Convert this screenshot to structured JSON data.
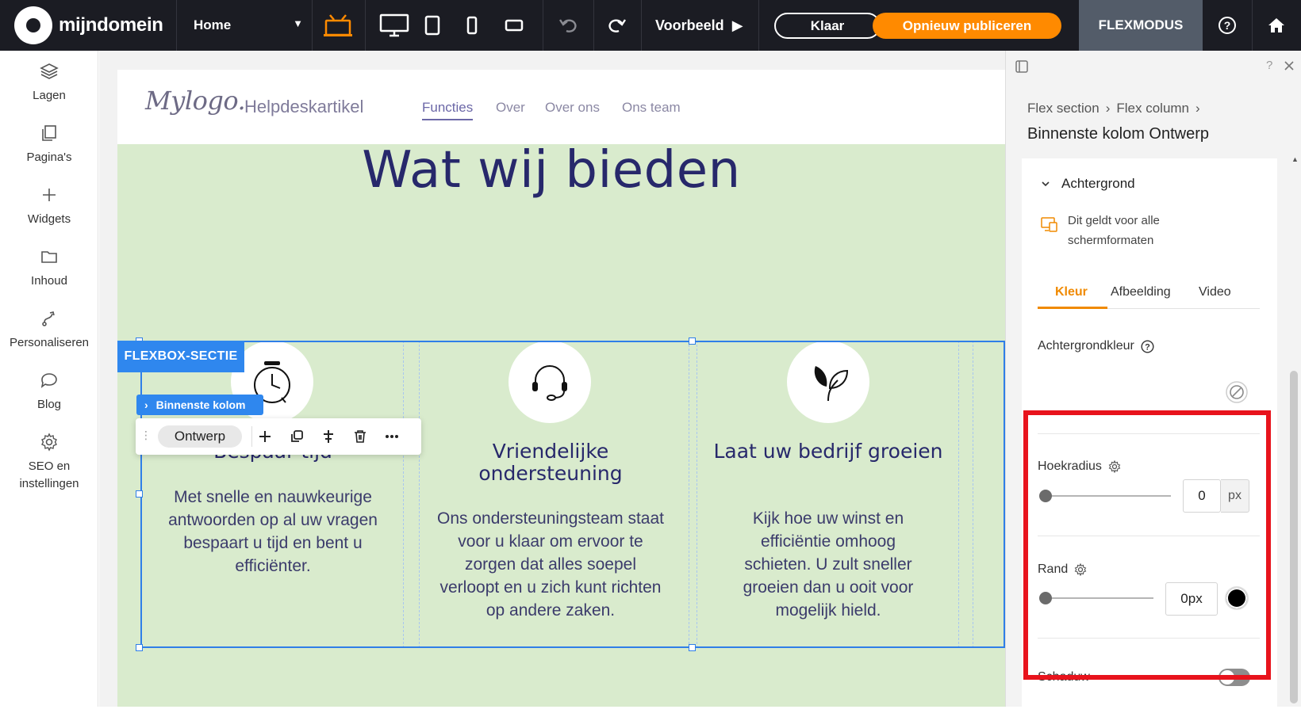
{
  "topbar": {
    "brand": "mijndomein",
    "page_selector": "Home",
    "preview_label": "Voorbeeld",
    "done_label": "Klaar",
    "publish_label": "Opnieuw publiceren",
    "flexmode_label": "FLEXMODUS",
    "accent_color": "#ff8a00"
  },
  "sidebar": {
    "items": [
      {
        "label": "Lagen",
        "icon": "layers-icon"
      },
      {
        "label": "Pagina's",
        "icon": "pages-icon"
      },
      {
        "label": "Widgets",
        "icon": "plus-icon"
      },
      {
        "label": "Inhoud",
        "icon": "folder-icon"
      },
      {
        "label": "Personaliseren",
        "icon": "personalize-icon"
      },
      {
        "label": "Blog",
        "icon": "chat-bubble-icon"
      },
      {
        "label": "SEO en instellingen",
        "icon": "gear-icon"
      }
    ]
  },
  "site": {
    "logo": "Mylogo.",
    "title": "Helpdeskartikel",
    "nav": [
      "Functies",
      "Over",
      "Over ons",
      "Ons team"
    ],
    "hero_title": "Wat wij bieden",
    "background_color": "#d9ebcd",
    "cards": [
      {
        "icon": "alarm-clock-icon",
        "title": "Bespaar tijd",
        "text": "Met snelle en nauwkeurige antwoorden op al uw vragen bespaart u tijd en bent u efficiënter."
      },
      {
        "icon": "headset-icon",
        "title": "Vriendelijke ondersteuning",
        "text": "Ons ondersteuningsteam staat voor u klaar om ervoor te zorgen dat alles soepel verloopt en u zich kunt richten op andere zaken."
      },
      {
        "icon": "leaf-plant-icon",
        "title": "Laat uw bedrijf groeien",
        "text": "Kijk hoe uw winst en efficiëntie omhoog schieten. U zult sneller groeien dan u ooit voor mogelijk hield."
      }
    ]
  },
  "editor": {
    "flexbox_label": "FLEXBOX-SECTIE",
    "inner_column_label": "Binnenste kolom",
    "toolbar_ontwerp": "Ontwerp",
    "selection_color": "#2f7ee8"
  },
  "panel": {
    "breadcrumb": [
      "Flex section",
      "Flex column"
    ],
    "title": "Binnenste kolom Ontwerp",
    "section": "Achtergrond",
    "info": "Dit geldt voor alle schermformaten",
    "tabs": [
      "Kleur",
      "Afbeelding",
      "Video"
    ],
    "active_tab": "Kleur",
    "background_color_label": "Achtergrondkleur",
    "corner_radius_label": "Hoekradius",
    "corner_radius_value": "0",
    "corner_radius_unit": "px",
    "border_label": "Rand",
    "border_value": "0px",
    "border_color": "#000000",
    "shadow_label": "Schaduw",
    "shadow_enabled": false,
    "highlight_color": "#e8131c"
  }
}
